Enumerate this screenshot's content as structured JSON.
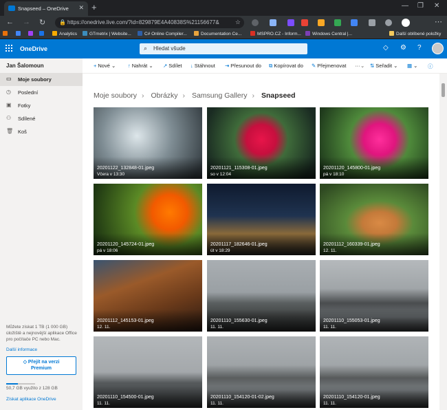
{
  "browser": {
    "tab_title": "Snapseed – OneDrive",
    "tab_close": "✕",
    "new_tab": "+",
    "url": "https://onedrive.live.com/?id=829879E4A40838S%21156677&",
    "bookmarks": [
      {
        "label": "Analytics",
        "color": "#f9ab00"
      },
      {
        "label": "GTmetrix | Website...",
        "color": "#3c8dbc"
      },
      {
        "label": "C# Online Compiler...",
        "color": "#2d5fa8"
      },
      {
        "label": "Documentation Ce...",
        "color": "#e8a33c"
      },
      {
        "label": "MSPRO.CZ - Inform...",
        "color": "#d93025"
      },
      {
        "label": "Windows Central |...",
        "color": "#7b3fb5"
      }
    ],
    "bookmarks_other": "Další oblíbené položky"
  },
  "app": {
    "brand": "OneDrive",
    "search_placeholder": "Hledat všude",
    "accent": "#0078d4"
  },
  "sidebar": {
    "user": "Jan Šalomoun",
    "items": [
      {
        "label": "Moje soubory",
        "icon": "folder-icon",
        "active": true
      },
      {
        "label": "Poslední",
        "icon": "clock-icon",
        "active": false
      },
      {
        "label": "Fotky",
        "icon": "photo-icon",
        "active": false
      },
      {
        "label": "Sdílené",
        "icon": "people-icon",
        "active": false
      },
      {
        "label": "Koš",
        "icon": "trash-icon",
        "active": false
      }
    ],
    "promo": "Můžete získat 1 TB (1 000 GB) úložiště a nejnovější aplikace Office pro počítače PC nebo Mac.",
    "promo_link": "Další informace",
    "premium_line1": "Přejít na verzi",
    "premium_line2": "Premium",
    "storage_text": "50,7 GB využito z 128 GB",
    "storage_used_fraction": 0.396,
    "get_apps": "Získat aplikace OneDrive"
  },
  "commands": {
    "new": "Nové",
    "upload": "Nahrát",
    "share": "Sdílet",
    "download": "Stáhnout",
    "move": "Přesunout do",
    "copy": "Kopírovat do",
    "rename": "Přejmenovat",
    "more": "···",
    "sort": "Seřadit"
  },
  "breadcrumb": [
    "Moje soubory",
    "Obrázky",
    "Samsung Gallery",
    "Snapseed"
  ],
  "files": [
    {
      "name": "20201122_132848-01.jpeg",
      "date": "Včera v 13:30"
    },
    {
      "name": "20201121_115308-01.jpeg",
      "date": "so v 12:04"
    },
    {
      "name": "20201120_145800-01.jpeg",
      "date": "pá v 18:10"
    },
    {
      "name": "20201120_145724-01.jpeg",
      "date": "pá v 18:06"
    },
    {
      "name": "20201117_182646-01.jpeg",
      "date": "út v 18:29"
    },
    {
      "name": "20201112_160339-01.jpeg",
      "date": "12. 11."
    },
    {
      "name": "20201112_145153-01.jpeg",
      "date": "12. 11."
    },
    {
      "name": "20201110_155630-01.jpeg",
      "date": "11. 11."
    },
    {
      "name": "20201110_155053-01.jpeg",
      "date": "11. 11."
    },
    {
      "name": "20201110_154500-01.jpeg",
      "date": "11. 11."
    },
    {
      "name": "20201110_154120-01-02.jpeg",
      "date": "11. 11."
    },
    {
      "name": "20201110_154120-01.jpeg",
      "date": "11. 11."
    }
  ]
}
